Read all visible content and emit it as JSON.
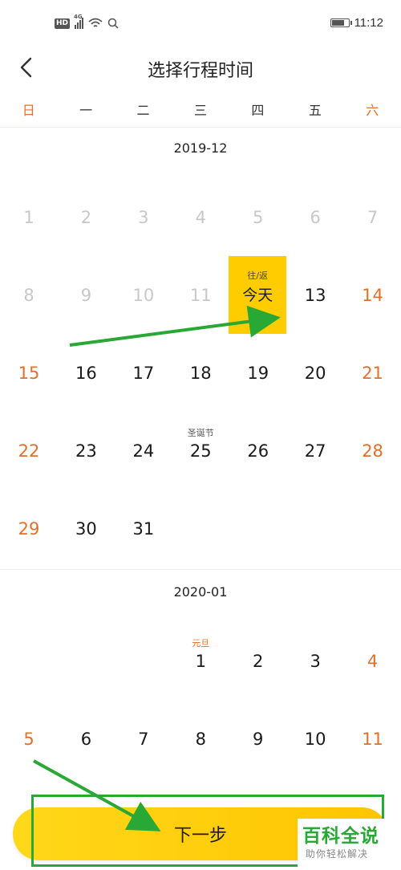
{
  "status_bar": {
    "hd": "HD",
    "network": "4G",
    "time": "11:12"
  },
  "header": {
    "title": "选择行程时间"
  },
  "weekdays": [
    "日",
    "一",
    "二",
    "三",
    "四",
    "五",
    "六"
  ],
  "months": [
    {
      "label": "2019-12",
      "first_weekday": 0,
      "days": [
        {
          "n": "1",
          "state": "past"
        },
        {
          "n": "2",
          "state": "past"
        },
        {
          "n": "3",
          "state": "past"
        },
        {
          "n": "4",
          "state": "past"
        },
        {
          "n": "5",
          "state": "past"
        },
        {
          "n": "6",
          "state": "past"
        },
        {
          "n": "7",
          "state": "past"
        },
        {
          "n": "8",
          "state": "past"
        },
        {
          "n": "9",
          "state": "past"
        },
        {
          "n": "10",
          "state": "past"
        },
        {
          "n": "11",
          "state": "past"
        },
        {
          "n": "今天",
          "state": "today",
          "note": "往/返"
        },
        {
          "n": "13"
        },
        {
          "n": "14"
        },
        {
          "n": "15"
        },
        {
          "n": "16"
        },
        {
          "n": "17"
        },
        {
          "n": "18"
        },
        {
          "n": "19"
        },
        {
          "n": "20"
        },
        {
          "n": "21"
        },
        {
          "n": "22"
        },
        {
          "n": "23"
        },
        {
          "n": "24"
        },
        {
          "n": "25",
          "note": "圣诞节"
        },
        {
          "n": "26"
        },
        {
          "n": "27"
        },
        {
          "n": "28"
        },
        {
          "n": "29"
        },
        {
          "n": "30"
        },
        {
          "n": "31"
        }
      ]
    },
    {
      "label": "2020-01",
      "first_weekday": 3,
      "days": [
        {
          "n": "1",
          "note": "元旦",
          "holiday": true
        },
        {
          "n": "2"
        },
        {
          "n": "3"
        },
        {
          "n": "4"
        },
        {
          "n": "5"
        },
        {
          "n": "6"
        },
        {
          "n": "7"
        },
        {
          "n": "8"
        },
        {
          "n": "9"
        },
        {
          "n": "10"
        },
        {
          "n": "11"
        }
      ]
    }
  ],
  "footer": {
    "next_label": "下一步"
  },
  "watermark": {
    "main": "百科全说",
    "sub": "助你轻松解决"
  },
  "colors": {
    "accent": "#ffcc00",
    "weekend": "#e0702a",
    "annotation": "#2aa835"
  }
}
